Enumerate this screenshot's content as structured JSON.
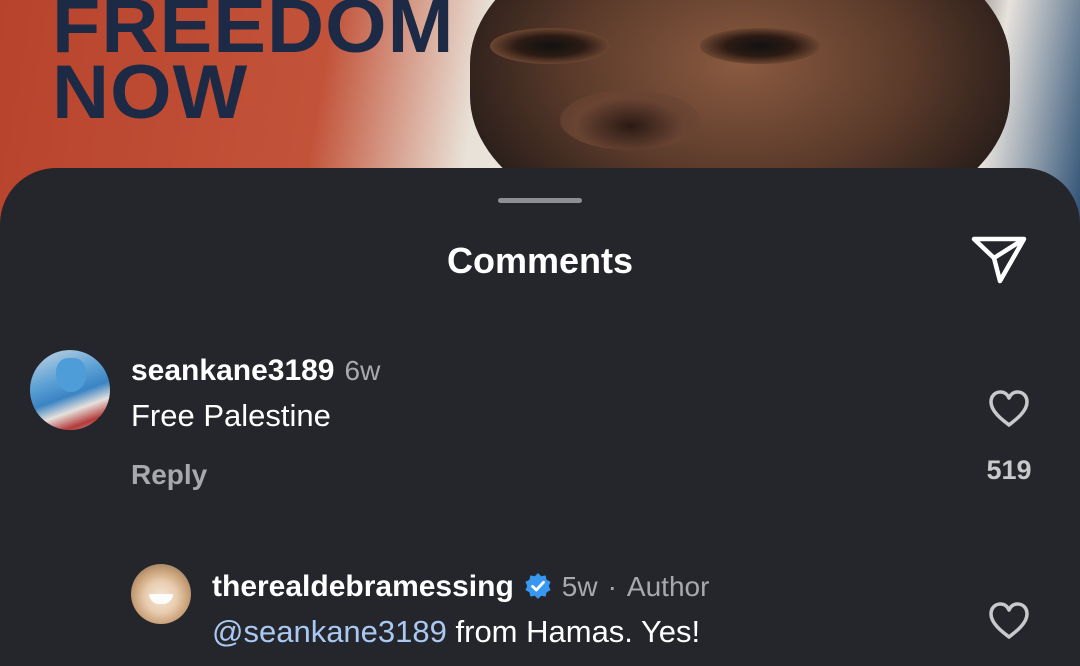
{
  "post": {
    "headline": "FREEDOM\nNOW"
  },
  "sheet": {
    "title": "Comments",
    "share_icon": "send-paper-plane-icon"
  },
  "comments": [
    {
      "username": "seankane3189",
      "time": "6w",
      "text": "Free Palestine",
      "reply_label": "Reply",
      "like_count": "519",
      "like_icon": "heart-outline-icon"
    },
    {
      "username": "therealdebramessing",
      "verified": true,
      "time": "5w",
      "separator": "·",
      "role": "Author",
      "mention": "@seankane3189",
      "text": " from Hamas. Yes!",
      "like_icon": "heart-outline-icon"
    }
  ],
  "colors": {
    "sheet_bg": "#25262b",
    "mention": "#a9c9f2",
    "verified_badge": "#3897f0",
    "meta_text": "#a8a8ad"
  }
}
